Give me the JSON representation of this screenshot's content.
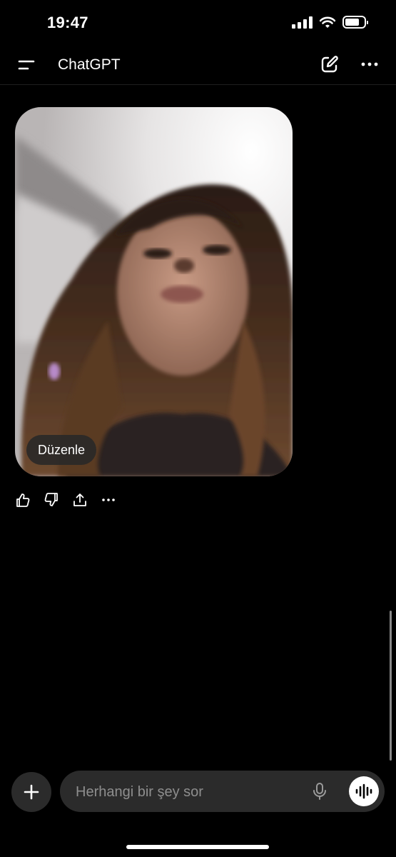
{
  "status_bar": {
    "time": "19:47",
    "battery_level": 0.75
  },
  "header": {
    "title": "ChatGPT",
    "icons": {
      "menu": "menu-icon",
      "new_chat": "new-chat-icon",
      "more": "more-icon"
    }
  },
  "message": {
    "image_alt": "photo",
    "edit_label": "Düzenle",
    "actions": [
      "thumbs-up-icon",
      "thumbs-down-icon",
      "share-icon",
      "more-icon"
    ]
  },
  "composer": {
    "placeholder": "Herhangi bir şey sor",
    "value": "",
    "icons": {
      "attach": "plus-icon",
      "mic": "microphone-icon",
      "voice": "voice-mode-icon"
    }
  },
  "colors": {
    "background": "#000000",
    "surface": "#2b2b2b",
    "placeholder": "#8e8e8e"
  }
}
